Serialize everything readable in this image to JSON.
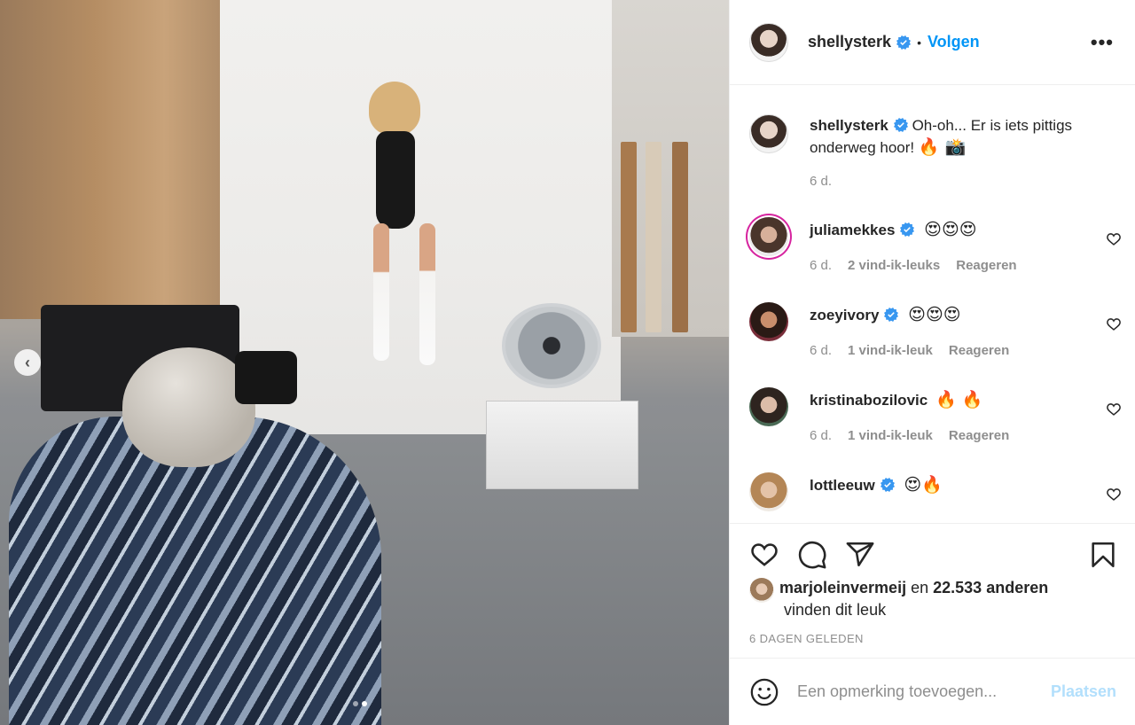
{
  "post": {
    "author": "shellysterk",
    "follow_label": "Volgen",
    "separator": "•",
    "more_label": "•••",
    "caption_text": "Oh-oh... Er is iets pittigs onderweg hoor!",
    "caption_emojis": "🔥 📸",
    "caption_age": "6 d.",
    "carousel": {
      "prev_label": "‹",
      "slides": 2,
      "active_slide": 2
    }
  },
  "comments": [
    {
      "user": "juliamekkes",
      "emojis": "😍😍😍",
      "age": "6 d.",
      "likes": "2 vind-ik-leuks",
      "reply": "Reageren"
    },
    {
      "user": "zoeyivory",
      "emojis": "😍😍😍",
      "age": "6 d.",
      "likes": "1 vind-ik-leuk",
      "reply": "Reageren"
    },
    {
      "user": "kristinabozilovic",
      "emojis": "🔥 🔥",
      "age": "6 d.",
      "likes": "1 vind-ik-leuk",
      "reply": "Reageren"
    },
    {
      "user": "lottleeuw",
      "emojis": "😍🔥",
      "age": "",
      "likes": "",
      "reply": ""
    }
  ],
  "likes_summary": {
    "user": "marjoleinvermeij",
    "middle": "en",
    "count": "22.533 anderen",
    "suffix": "vinden dit leuk"
  },
  "timestamp": "6 DAGEN GELEDEN",
  "composer": {
    "placeholder": "Een opmerking toevoegen...",
    "post_label": "Plaatsen"
  },
  "colors": {
    "accent": "#0095f6",
    "post_disabled": "#b2dffc",
    "muted": "#8e8e8e",
    "text": "#262626"
  },
  "icons": [
    "verified-badge-icon",
    "heart-icon",
    "comment-icon",
    "share-icon",
    "bookmark-icon",
    "emoji-icon",
    "chevron-left-icon"
  ]
}
